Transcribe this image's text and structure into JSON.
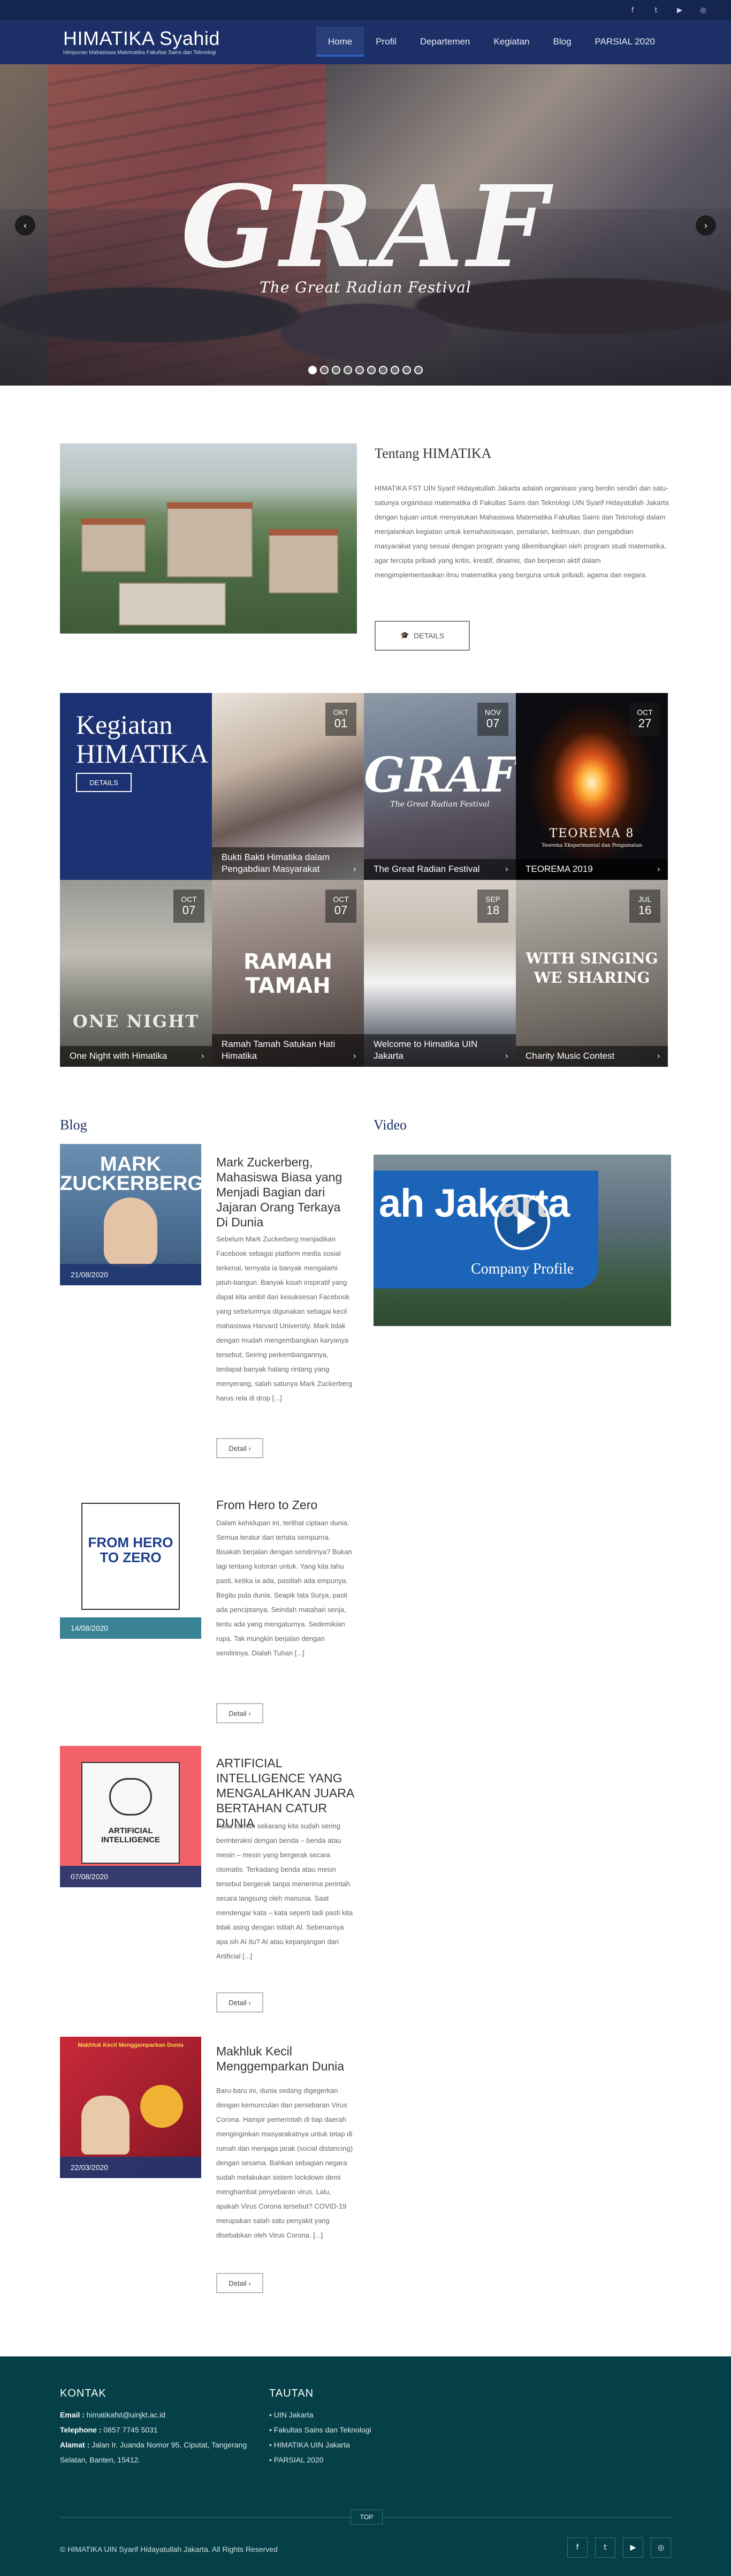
{
  "topbar": {
    "socials": [
      "f",
      "t",
      "▶",
      "◎"
    ]
  },
  "header": {
    "title": "HIMATIKA Syahid",
    "subtitle": "Himpunan Mahasiswa Matematika Fakultas Sains dan Teknologi",
    "nav": [
      "Home",
      "Profil",
      "Departemen",
      "Kegiatan",
      "Blog",
      "PARSIAL 2020"
    ]
  },
  "hero": {
    "headline": "GRAF",
    "subheadline": "The Great Radian Festival",
    "prev": "‹",
    "next": "›",
    "slides_total": 10,
    "active_slide": 1
  },
  "about": {
    "title": "Tentang HIMATIKA",
    "text": "HIMATIKA FST UIN Syarif Hidayatullah Jakarta adalah organisasi yang berdiri sendiri dan satu-satunya organisasi matematika di Fakultas Sains dan Teknologi UIN Syarif Hidayatullah Jakarta dengan tujuan untuk menyatukan Mahasiswa Matematika Fakultas Sains dan Teknologi dalam menjalankan kegiatan untuk kemahasiswaan, penalaran, keilmuan, dan pengabdian masyarakat yang sesuai dengan program yang dikembangkan oleh program studi matematika, agar tercipta pribadi yang kritis, kreatif, dinamis, dan berperan aktif dalam mengimplementasikan ilmu matematika yang berguna untuk pribadi, agama dan negara.",
    "button": "DETAILS"
  },
  "kegiatan": {
    "title": "Kegiatan HIMATIKA",
    "button": "DETAILS",
    "cards": [
      {
        "month": "OKT",
        "day": "01",
        "title": "Bukti Bakti Himatika dalam Pengabdian Masyarakat"
      },
      {
        "month": "NOV",
        "day": "07",
        "title": "The Great Radian Festival"
      },
      {
        "month": "OCT",
        "day": "27",
        "title": "TEOREMA 2019"
      },
      {
        "month": "OCT",
        "day": "07",
        "title": "One Night with Himatika"
      },
      {
        "month": "OCT",
        "day": "07",
        "title": "Ramah Tamah Satukan Hati Himatika"
      },
      {
        "month": "SEP",
        "day": "18",
        "title": "Welcome to Himatika UIN Jakarta"
      },
      {
        "month": "JUL",
        "day": "16",
        "title": "Charity Music Contest"
      }
    ],
    "overlays": {
      "graf": "GRAF",
      "graf_sub": "The Great Radian Festival",
      "teorema": "TEOREMA 8",
      "teorema_sub": "Teorema Eksperimental dan Pengamatan",
      "onenight": "ONE NIGHT",
      "ramah": "RAMAH",
      "tamah": "TAMAH",
      "sing": "WITH SINGING",
      "share": "WE SHARING"
    }
  },
  "blog": {
    "title": "Blog",
    "detail_label": "Detail ›",
    "posts": [
      {
        "date": "21/08/2020",
        "title": "Mark Zuckerberg, Mahasiswa Biasa yang Menjadi Bagian dari Jajaran Orang Terkaya Di Dunia",
        "excerpt": "Sebelum Mark Zuckerberg menjadikan Facebook sebagai platform media sosial terkenal, ternyata ia banyak mengalami jatuh-bangun. Banyak kisah inspiratif yang dapat kita ambil dari kesuksesan Facebook yang sebelumnya digunakan sebagai kecil mahasiswa Harvard University. Mark tidak dengan mudah mengembangkan karyanya tersebut; Seiring perkembangannya, terdapat banyak halang rintang yang menyerang, salah satunya Mark Zuckerberg harus rela di drop [...]",
        "image_text": "MARK ZUCKERBERG"
      },
      {
        "date": "14/08/2020",
        "title": "From Hero to Zero",
        "excerpt": "Dalam kehidupan ini, terlihat ciptaan dunia. Semua teratur dan tertata sempurna. Bisakah berjalan dengan sendirinya? Bukan lagi tentang kotoran untuk. Yang kita tahu pasti, ketika ia ada, pastilah ada empunya. Begitu pula dunia. Seapik tata Surya, pasti ada penciptanya. Seindah matahari senja, tentu ada yang mengaturnya. Sedemikian rupa. Tak mungkin berjalan dengan sendirinya. Dialah Tuhan [...]",
        "image_text": "FROM HERO TO ZERO"
      },
      {
        "date": "07/08/2020",
        "title": "ARTIFICIAL INTELLIGENCE YANG MENGALAHKAN JUARA BERTAHAN CATUR DUNIA",
        "excerpt": "Pada zaman sekarang kita sudah sering berinteraksi dengan benda – benda atau mesin – mesin yang bergerak secara otomatis. Terkadang benda atau mesin tersebut bergerak tanpa menerima perintah secara langsung oleh manusia. Saat mendengar kata – kata seperti tadi pasti kita tidak asing dengan istilah AI. Sebenarnya apa sih AI itu? AI atau kepanjangan dari Artificial [...]",
        "image_text": "ARTIFICIAL INTELLIGENCE"
      },
      {
        "date": "22/03/2020",
        "title": "Makhluk Kecil Menggemparkan Dunia",
        "excerpt": "Baru-baru ini, dunia sedang digegerkan dengan kemunculan dan persebaran Virus Corona. Hampir pemerintah di tiap daerah menginginkan masyarakatnya untuk tetap di rumah dan menjaga jarak (social distancing) dengan sesama. Bahkan sebagian negara sudah melakukan sistem lockdown demi menghambat penyebaran virus. Lalu, apakah Virus Corona tersebut? COVID-19 merupakan salah satu penyakit yang disebabkan oleh Virus Corona. [...]",
        "image_text": "Makhluk Kecil Menggemparkan Dunia"
      }
    ]
  },
  "video": {
    "title": "Video",
    "sign": "ah Jakarta",
    "caption": "Company Profile"
  },
  "footer": {
    "kontak_title": "KONTAK",
    "email_label": "Email :",
    "email": "himatikafst@uinjkt.ac.id",
    "phone_label": "Telephone :",
    "phone": "0857 7745 5031",
    "address_label": "Alamat :",
    "address_line1": "Jalan Ir. Juanda Nomor 95, Ciputat, Tangerang",
    "address_line2": "Selatan, Banten, 15412.",
    "tautan_title": "TAUTAN",
    "links": [
      "• UIN Jakarta",
      "• Fakultas Sains dan Teknologi",
      "• HIMATIKA UIN Jakarta",
      "• PARSIAL 2020"
    ],
    "top": "TOP",
    "copyright": "© HIMATIKA UIN Syarif Hidayatullah Jakarta. All Rights Reserved",
    "socials": [
      "f",
      "t",
      "▶",
      "◎"
    ]
  },
  "colors": {
    "nav": "#1c2f66",
    "topbar": "#14254f",
    "accent": "#1d3273",
    "footer": "#054048"
  }
}
